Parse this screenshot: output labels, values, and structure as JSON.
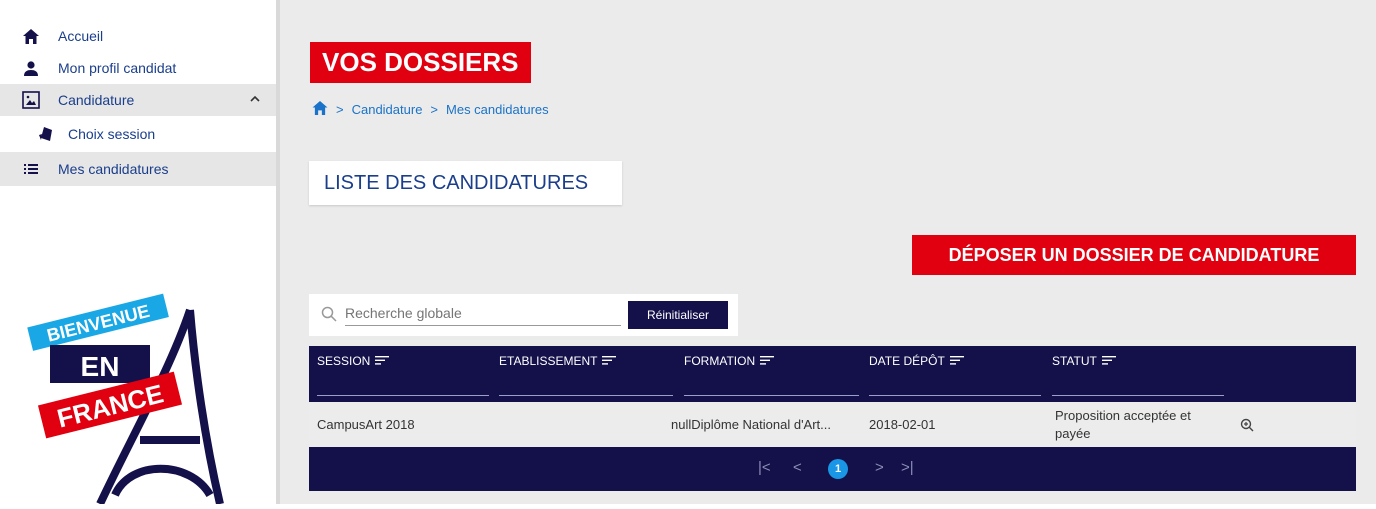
{
  "sidebar": {
    "items": [
      {
        "label": "Accueil",
        "icon": "home-icon"
      },
      {
        "label": "Mon profil candidat",
        "icon": "person-icon"
      },
      {
        "label": "Candidature",
        "icon": "candidature-icon",
        "expanded": true
      },
      {
        "label": "Choix session",
        "icon": "session-icon"
      },
      {
        "label": "Mes candidatures",
        "icon": "list-icon",
        "active": true
      }
    ],
    "logo": {
      "line1": "BIENVENUE",
      "line2": "EN",
      "line3": "FRANCE"
    }
  },
  "main": {
    "title": "VOS DOSSIERS",
    "breadcrumb": [
      "Candidature",
      "Mes candidatures"
    ],
    "section_title": "LISTE DES CANDIDATURES",
    "deposit_button": "DÉPOSER UN DOSSIER DE CANDIDATURE",
    "search": {
      "placeholder": "Recherche globale",
      "reset_label": "Réinitialiser"
    },
    "table": {
      "headers": [
        "SESSION",
        "ETABLISSEMENT",
        "FORMATION",
        "DATE DÉPÔT",
        "STATUT"
      ],
      "rows": [
        {
          "session": "CampusArt 2018",
          "etablissement": "",
          "formation": "nullDiplôme National d'Art...",
          "date": "2018-02-01",
          "statut": "Proposition acceptée et payée"
        }
      ]
    },
    "pagination": {
      "current": "1"
    }
  },
  "colors": {
    "red": "#e1000f",
    "navy": "#14104a",
    "blue_text": "#1a3e8c",
    "link": "#1a73c8",
    "page_dot": "#1a96e6"
  }
}
